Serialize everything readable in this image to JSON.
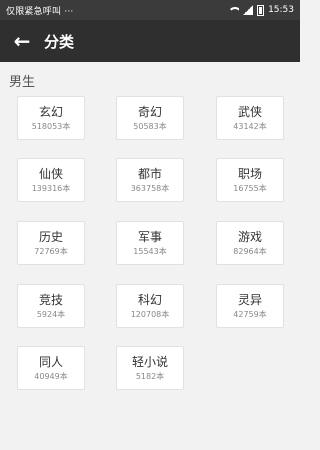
{
  "status_bar": {
    "left_text": "仅限紧急呼叫 ···",
    "time": "15:53",
    "icons": [
      "wifi-icon",
      "signal-icon",
      "battery-icon"
    ]
  },
  "app_bar": {
    "back_icon": "arrow-left-icon",
    "back_glyph": "←",
    "title": "分类"
  },
  "section": {
    "title": "男生"
  },
  "categories": [
    {
      "name": "玄幻",
      "count": "518053本"
    },
    {
      "name": "奇幻",
      "count": "50583本"
    },
    {
      "name": "武侠",
      "count": "43142本"
    },
    {
      "name": "仙侠",
      "count": "139316本"
    },
    {
      "name": "都市",
      "count": "363758本"
    },
    {
      "name": "职场",
      "count": "16755本"
    },
    {
      "name": "历史",
      "count": "72769本"
    },
    {
      "name": "军事",
      "count": "15543本"
    },
    {
      "name": "游戏",
      "count": "82964本"
    },
    {
      "name": "竞技",
      "count": "5924本"
    },
    {
      "name": "科幻",
      "count": "120708本"
    },
    {
      "name": "灵异",
      "count": "42759本"
    },
    {
      "name": "同人",
      "count": "40949本"
    },
    {
      "name": "轻小说",
      "count": "5182本"
    }
  ],
  "colors": {
    "status_bar_bg": "#3b3b3b",
    "app_bar_bg": "#2f2f2f",
    "page_bg": "#f2f2f2",
    "card_bg": "#ffffff",
    "card_border": "#e1e1e1"
  }
}
